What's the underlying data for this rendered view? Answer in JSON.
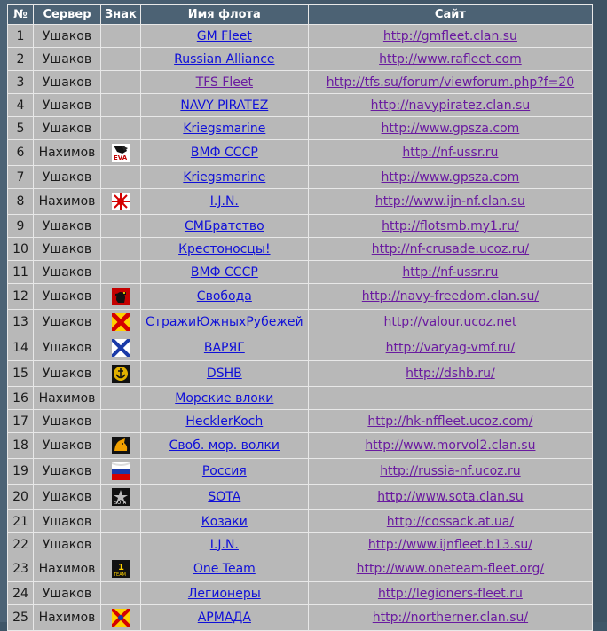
{
  "headers": {
    "num": "№",
    "server": "Сервер",
    "emblem": "Знак",
    "fleet": "Имя флота",
    "site": "Сайт"
  },
  "rows": [
    {
      "num": "1",
      "server": "Ушаков",
      "emblem": "",
      "fleet": "GM Fleet",
      "site": "http://gmfleet.clan.su",
      "visited": false
    },
    {
      "num": "2",
      "server": "Ушаков",
      "emblem": "",
      "fleet": "Russian Alliance",
      "site": "http://www.rafleet.com",
      "visited": false
    },
    {
      "num": "3",
      "server": "Ушаков",
      "emblem": "",
      "fleet": "TFS Fleet",
      "site": "http://tfs.su/forum/viewforum.php?f=20",
      "visited": true
    },
    {
      "num": "4",
      "server": "Ушаков",
      "emblem": "",
      "fleet": "NAVY PIRATEZ",
      "site": "http://navypiratez.clan.su",
      "visited": false
    },
    {
      "num": "5",
      "server": "Ушаков",
      "emblem": "",
      "fleet": "Kriegsmarine",
      "site": "http://www.gpsza.com",
      "visited": false
    },
    {
      "num": "6",
      "server": "Нахимов",
      "emblem": "eva-emblem-icon",
      "fleet": "ВМФ СССР",
      "site": "http://nf-ussr.ru",
      "visited": false
    },
    {
      "num": "7",
      "server": "Ушаков",
      "emblem": "",
      "fleet": "Kriegsmarine",
      "site": "http://www.gpsza.com",
      "visited": false
    },
    {
      "num": "8",
      "server": "Нахимов",
      "emblem": "rising-sun-icon",
      "fleet": "I.J.N.",
      "site": "http://www.ijn-nf.clan.su",
      "visited": false
    },
    {
      "num": "9",
      "server": "Ушаков",
      "emblem": "",
      "fleet": "СМБратство",
      "site": "http://flotsmb.my1.ru/",
      "visited": false
    },
    {
      "num": "10",
      "server": "Ушаков",
      "emblem": "",
      "fleet": "Крестоносцы!",
      "site": "http://nf-crusade.ucoz.ru/",
      "visited": false
    },
    {
      "num": "11",
      "server": "Ушаков",
      "emblem": "",
      "fleet": "ВМФ СССР",
      "site": "http://nf-ussr.ru",
      "visited": false
    },
    {
      "num": "12",
      "server": "Ушаков",
      "emblem": "che-portrait-icon",
      "fleet": "Свобода",
      "site": "http://navy-freedom.clan.su/",
      "visited": false
    },
    {
      "num": "13",
      "server": "Ушаков",
      "emblem": "red-saltire-icon",
      "fleet": "СтражиЮжныхРубежей",
      "site": "http://valour.ucoz.net",
      "visited": false
    },
    {
      "num": "14",
      "server": "Ушаков",
      "emblem": "st-andrew-flag-icon",
      "fleet": "ВАРЯГ",
      "site": "http://varyag-vmf.ru/",
      "visited": false
    },
    {
      "num": "15",
      "server": "Ушаков",
      "emblem": "anchor-badge-icon",
      "fleet": "DSHB",
      "site": "http://dshb.ru/",
      "visited": false
    },
    {
      "num": "16",
      "server": "Нахимов",
      "emblem": "",
      "fleet": "Морские влоки",
      "site": "",
      "visited": false
    },
    {
      "num": "17",
      "server": "Ушаков",
      "emblem": "",
      "fleet": "HecklerKoch",
      "site": "http://hk-nffleet.ucoz.com/",
      "visited": false
    },
    {
      "num": "18",
      "server": "Ушаков",
      "emblem": "wolf-head-icon",
      "fleet": "Своб. мор. волки",
      "site": "http://www.morvol2.clan.su",
      "visited": false
    },
    {
      "num": "19",
      "server": "Ушаков",
      "emblem": "russian-flag-icon",
      "fleet": "Россия",
      "site": "http://russia-nf.ucoz.ru",
      "visited": false
    },
    {
      "num": "20",
      "server": "Ушаков",
      "emblem": "sota-badge-icon",
      "fleet": "SOTA",
      "site": "http://www.sota.clan.su",
      "visited": false
    },
    {
      "num": "21",
      "server": "Ушаков",
      "emblem": "",
      "fleet": "Козаки",
      "site": "http://cossack.at.ua/",
      "visited": false
    },
    {
      "num": "22",
      "server": "Ушаков",
      "emblem": "",
      "fleet": "I.J.N.",
      "site": "http://www.ijnfleet.b13.su/",
      "visited": false
    },
    {
      "num": "23",
      "server": "Нахимов",
      "emblem": "one-team-badge-icon",
      "fleet": "One Team",
      "site": "http://www.oneteam-fleet.org/",
      "visited": false
    },
    {
      "num": "24",
      "server": "Ушаков",
      "emblem": "",
      "fleet": "Легионеры",
      "site": "http://legioners-fleet.ru",
      "visited": false
    },
    {
      "num": "25",
      "server": "Нахимов",
      "emblem": "armada-emblem-icon",
      "fleet": "АРМАДА",
      "site": "http://northerner.clan.su/",
      "visited": false
    }
  ],
  "emblem_text": {
    "eva": "EVA",
    "sota": "SOTA",
    "one_team_numeral": "1",
    "one_team_word": "TEAM"
  }
}
